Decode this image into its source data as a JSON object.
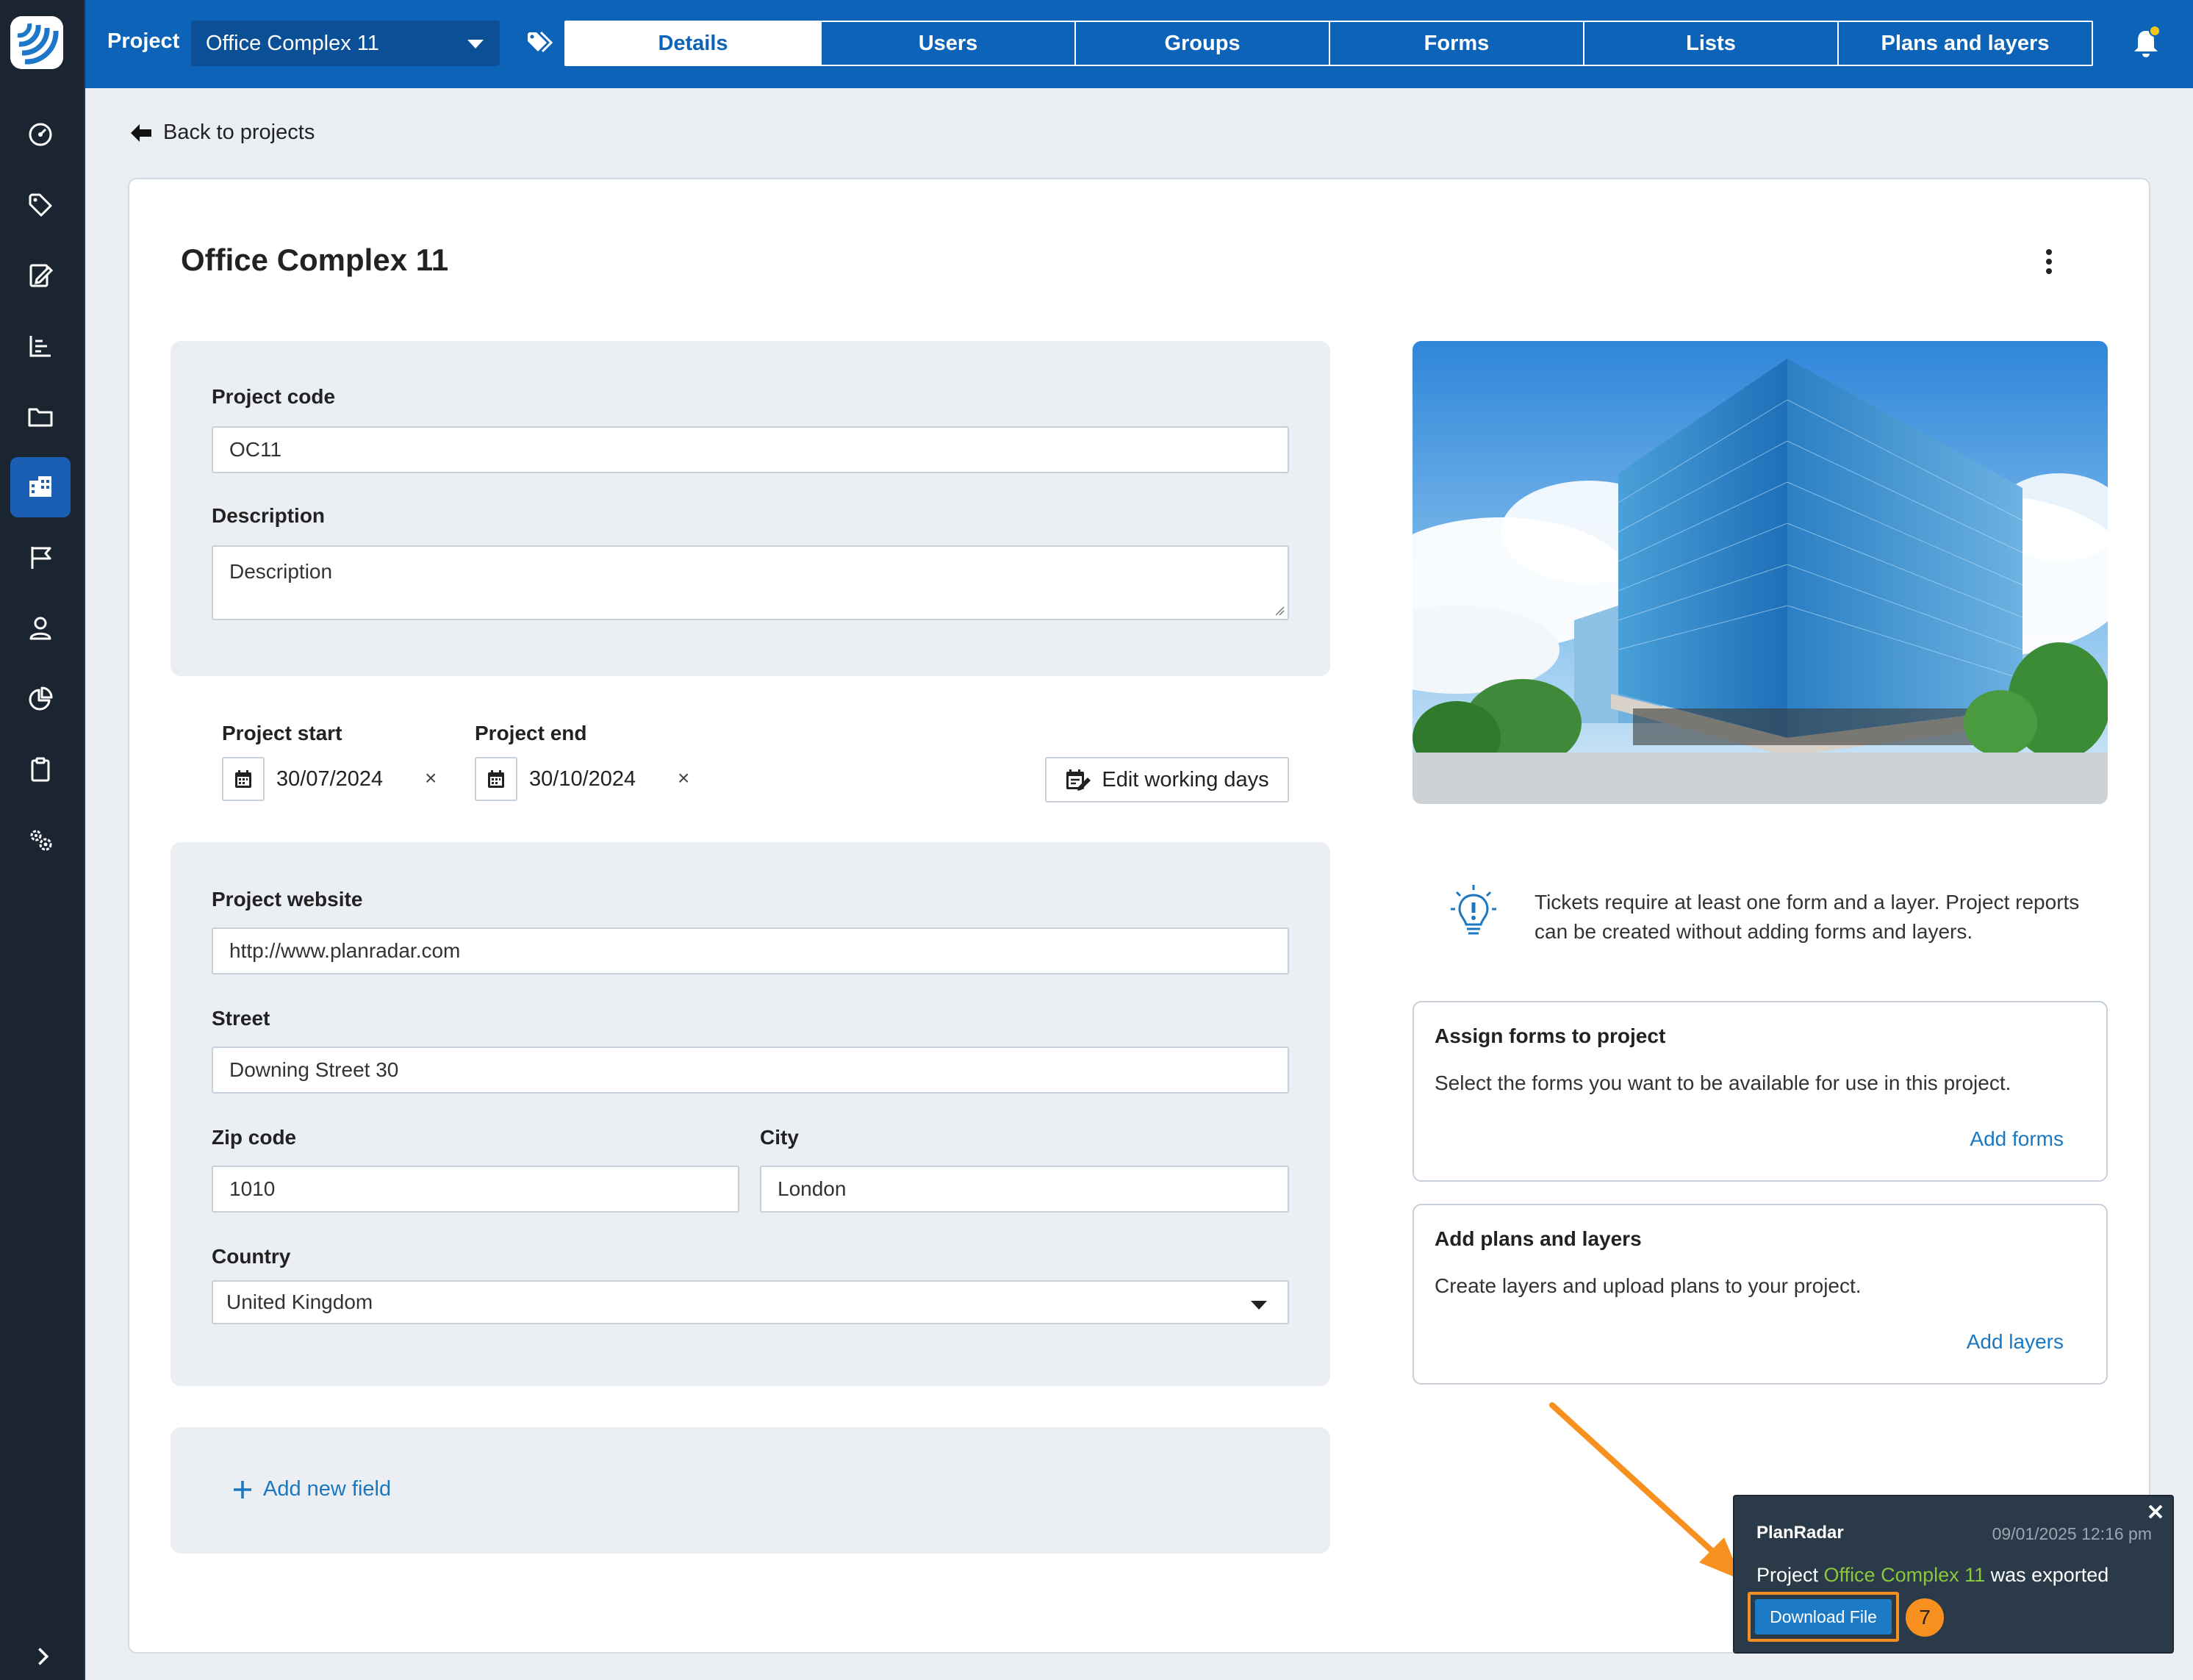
{
  "topbar": {
    "project_label": "Project",
    "project_selected": "Office Complex 11",
    "tabs": [
      {
        "label": "Details"
      },
      {
        "label": "Users"
      },
      {
        "label": "Groups"
      },
      {
        "label": "Forms"
      },
      {
        "label": "Lists"
      },
      {
        "label": "Plans and layers"
      }
    ]
  },
  "nav": {
    "back_label": "Back to projects"
  },
  "page": {
    "title": "Office Complex 11"
  },
  "form": {
    "project_code_label": "Project code",
    "project_code_value": "OC11",
    "description_label": "Description",
    "description_placeholder": "Description",
    "start_label": "Project start",
    "start_value": "30/07/2024",
    "end_label": "Project end",
    "end_value": "30/10/2024",
    "clear_glyph": "×",
    "edit_days_label": "Edit working days",
    "website_label": "Project website",
    "website_value": "http://www.planradar.com",
    "street_label": "Street",
    "street_value": "Downing Street 30",
    "zip_label": "Zip code",
    "zip_value": "1010",
    "city_label": "City",
    "city_value": "London",
    "country_label": "Country",
    "country_value": "United Kingdom",
    "add_field_label": "Add new field"
  },
  "side": {
    "hint": "Tickets require at least one form and a layer. Project reports can be created without adding forms and layers.",
    "forms_box": {
      "title": "Assign forms to project",
      "desc": "Select the forms you want to be available for use in this project.",
      "link": "Add forms"
    },
    "layers_box": {
      "title": "Add plans and layers",
      "desc": "Create layers and upload plans to your project.",
      "link": "Add layers"
    }
  },
  "toast": {
    "brand": "PlanRadar",
    "time": "09/01/2025 12:16 pm",
    "msg_prefix": "Project ",
    "msg_project": "Office Complex 11",
    "msg_suffix": " was exported",
    "download_label": "Download File",
    "step_number": "7"
  },
  "colors": {
    "sidebar_bg": "#1b2532",
    "topbar_bg": "#0d63b8",
    "link": "#1a78c2",
    "highlight_orange": "#f7901e",
    "toast_highlight": "#8ac73e"
  },
  "icons": {
    "sidebar": [
      "dashboard-icon",
      "tag-icon",
      "form-edit-icon",
      "chart-icon",
      "folder-icon",
      "building-icon",
      "flag-icon",
      "user-icon",
      "pie-chart-icon",
      "clipboard-icon",
      "settings-icon"
    ]
  }
}
